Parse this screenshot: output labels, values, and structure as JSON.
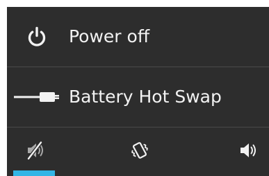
{
  "colors": {
    "dialog_background": "#2d2d2d",
    "text": "#f2f2f2",
    "divider": "#4a4a4a",
    "accent": "#33b5e5",
    "icon": "#f2f2f2",
    "icon_muted": "#a8a8a8"
  },
  "menu": {
    "items": [
      {
        "label": "Power off",
        "icon": "power-icon"
      },
      {
        "label": "Battery Hot Swap",
        "icon": "battery-plug-icon"
      }
    ]
  },
  "sound_modes": {
    "selected": "silent",
    "options": [
      {
        "mode": "silent",
        "icon": "speaker-muted-icon"
      },
      {
        "mode": "vibrate",
        "icon": "phone-vibrate-icon"
      },
      {
        "mode": "sound",
        "icon": "speaker-on-icon"
      }
    ]
  }
}
